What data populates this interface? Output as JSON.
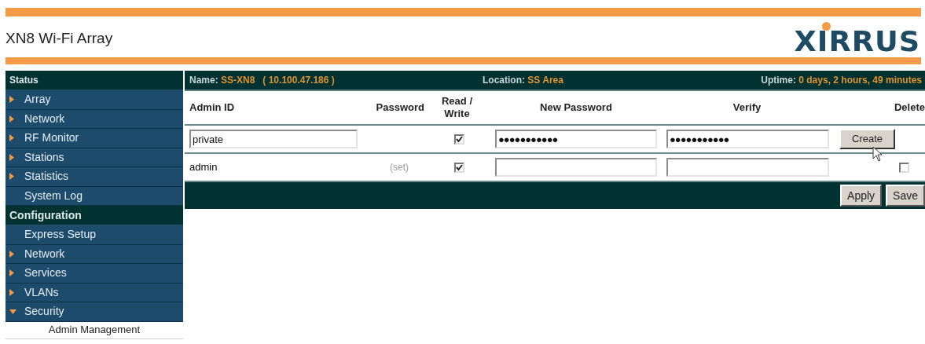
{
  "header": {
    "title": "XN8 Wi-Fi Array",
    "logo": "XIRRUS"
  },
  "sidebar": {
    "items": [
      {
        "kind": "header",
        "label": "Status"
      },
      {
        "kind": "folder",
        "label": "Array",
        "expanded": false,
        "selected": false
      },
      {
        "kind": "folder",
        "label": "Network",
        "expanded": false,
        "selected": false
      },
      {
        "kind": "folder",
        "label": "RF Monitor",
        "expanded": false,
        "selected": false
      },
      {
        "kind": "folder",
        "label": "Stations",
        "expanded": false,
        "selected": false
      },
      {
        "kind": "folder",
        "label": "Statistics",
        "expanded": false,
        "selected": false
      },
      {
        "kind": "link",
        "label": "System Log",
        "selected": false
      },
      {
        "kind": "header",
        "label": "Configuration"
      },
      {
        "kind": "link",
        "label": "Express Setup",
        "selected": false
      },
      {
        "kind": "folder",
        "label": "Network",
        "expanded": false,
        "selected": false
      },
      {
        "kind": "folder",
        "label": "Services",
        "expanded": false,
        "selected": false
      },
      {
        "kind": "folder",
        "label": "VLANs",
        "expanded": false,
        "selected": false
      },
      {
        "kind": "folder",
        "label": "Security",
        "expanded": true,
        "selected": false
      },
      {
        "kind": "sublink",
        "label": "Admin Management",
        "selected": true
      }
    ]
  },
  "info_bar": [
    {
      "label": "Name:",
      "value": "SS-XN8   ( 10.100.47.186 )"
    },
    {
      "label": "Location:",
      "value": "SS Area"
    },
    {
      "label": "Uptime:",
      "value": "0 days, 2 hours, 49 minutes"
    }
  ],
  "table": {
    "columns": [
      "Admin ID",
      "Password",
      "Read / Write",
      "New Password",
      "Verify",
      "Delete"
    ],
    "rows": [
      {
        "kind": "new",
        "admin_id": "private",
        "read_write": true,
        "new_password": "●●●●●●●●●●●",
        "verify": "●●●●●●●●●●●",
        "button": "Create"
      },
      {
        "kind": "existing",
        "admin_id": "admin",
        "password": "(set)",
        "read_write": true,
        "delete": false
      }
    ]
  },
  "actions": [
    "Apply",
    "Save"
  ]
}
